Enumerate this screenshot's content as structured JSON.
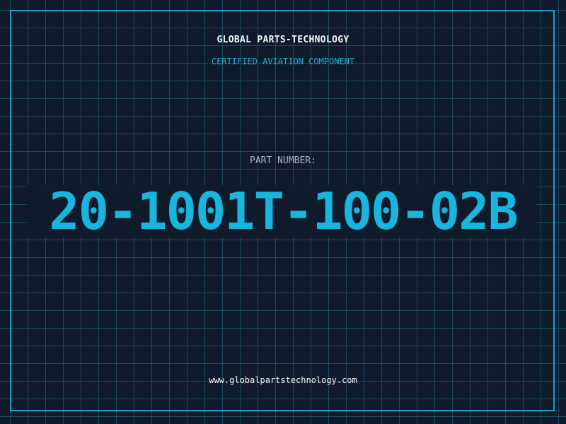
{
  "header": {
    "company": "GLOBAL PARTS-TECHNOLOGY",
    "tagline": "CERTIFIED AVIATION COMPONENT"
  },
  "part": {
    "label": "PART NUMBER:",
    "number": "20-1001T-100-02B"
  },
  "footer": {
    "website": "www.globalpartstechnology.com"
  },
  "colors": {
    "background": "#0f1a2b",
    "grid": "#266e87",
    "frame": "#1aa3c8",
    "accent": "#18b6de",
    "text": "#f2f5f8",
    "muted": "#aab4c0"
  }
}
